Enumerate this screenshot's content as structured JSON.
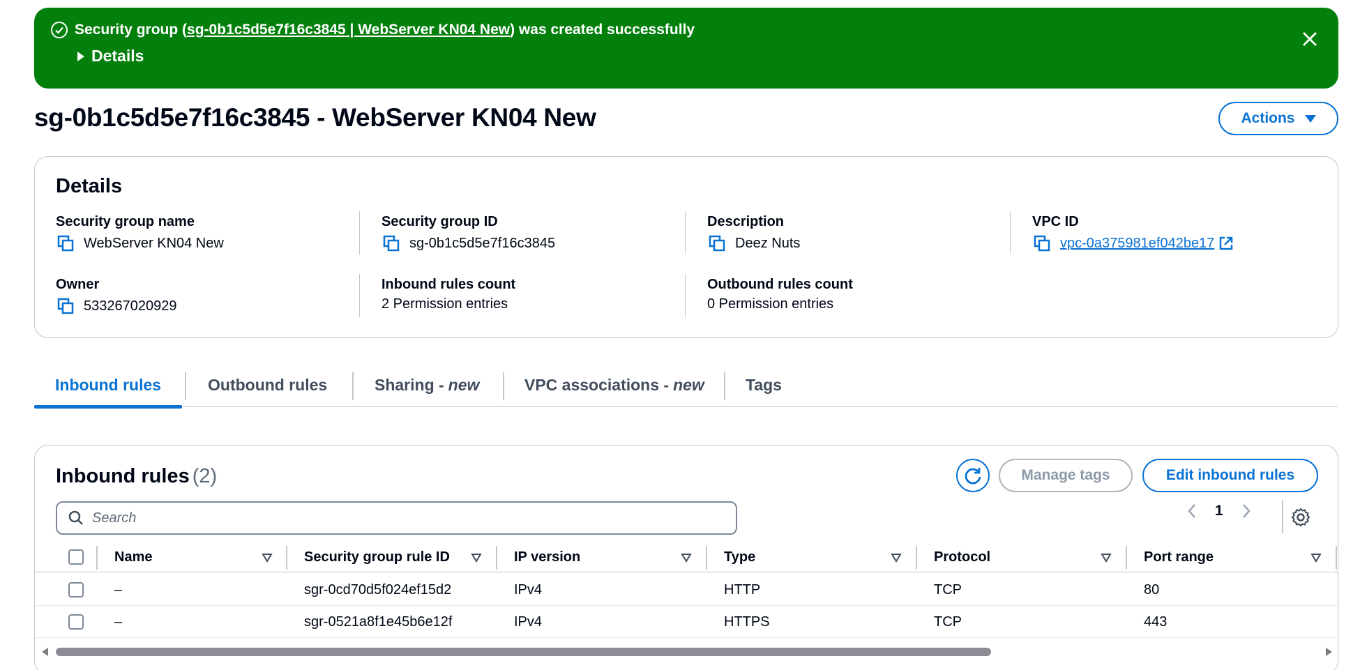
{
  "flash": {
    "prefix": "Security group (",
    "link": "sg-0b1c5d5e7f16c3845 | WebServer KN04 New",
    "suffix": ") was created successfully",
    "details_label": "Details",
    "color": "#037f0c"
  },
  "header": {
    "title": "sg-0b1c5d5e7f16c3845 - WebServer KN04 New",
    "actions_label": "Actions"
  },
  "details": {
    "heading": "Details",
    "fields": {
      "sg_name": {
        "label": "Security group name",
        "value": "WebServer KN04 New"
      },
      "sg_id": {
        "label": "Security group ID",
        "value": "sg-0b1c5d5e7f16c3845"
      },
      "description": {
        "label": "Description",
        "value": "Deez Nuts"
      },
      "vpc_id": {
        "label": "VPC ID",
        "value": "vpc-0a375981ef042be17"
      },
      "owner": {
        "label": "Owner",
        "value": "533267020929"
      },
      "inbound_count": {
        "label": "Inbound rules count",
        "value": "2 Permission entries"
      },
      "outbound_count": {
        "label": "Outbound rules count",
        "value": "0 Permission entries"
      }
    }
  },
  "tabs": [
    {
      "label": "Inbound rules",
      "suffix": "",
      "active": true
    },
    {
      "label": "Outbound rules",
      "suffix": ""
    },
    {
      "label": "Sharing -",
      "suffix": "new"
    },
    {
      "label": "VPC associations -",
      "suffix": "new"
    },
    {
      "label": "Tags",
      "suffix": ""
    }
  ],
  "inbound": {
    "title": "Inbound rules",
    "count": "(2)",
    "manage_tags_label": "Manage tags",
    "edit_label": "Edit inbound rules",
    "search_placeholder": "Search",
    "page": "1",
    "columns": [
      "Name",
      "Security group rule ID",
      "IP version",
      "Type",
      "Protocol",
      "Port range"
    ],
    "rows": [
      {
        "name": "–",
        "rule_id": "sgr-0cd70d5f024ef15d2",
        "ip_version": "IPv4",
        "type": "HTTP",
        "protocol": "TCP",
        "port_range": "80"
      },
      {
        "name": "–",
        "rule_id": "sgr-0521a8f1e45b6e12f",
        "ip_version": "IPv4",
        "type": "HTTPS",
        "protocol": "TCP",
        "port_range": "443"
      }
    ]
  },
  "colors": {
    "accent": "#0972d3",
    "success": "#037f0c",
    "border": "#c6c6cd"
  }
}
